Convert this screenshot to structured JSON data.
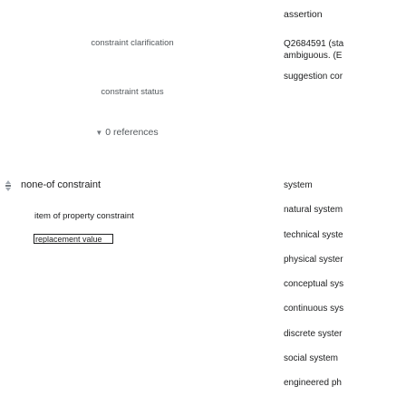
{
  "left": {
    "qualifier_label": "constraint clarification",
    "status_label": "constraint status",
    "references_label": "0 references",
    "statement_value": "none-of constraint",
    "qualifier_property": "item of property constraint",
    "edit_value": "replacement value"
  },
  "right": {
    "title": "assertion",
    "desc_line1": "Q2684591 (sta",
    "desc_line2": "ambiguous. (E",
    "desc_line3": "suggestion cor",
    "items": [
      "system",
      "natural system",
      "technical syste",
      "physical syster",
      "conceptual sys",
      "continuous sys",
      "discrete syster",
      "social system",
      "engineered ph"
    ]
  }
}
